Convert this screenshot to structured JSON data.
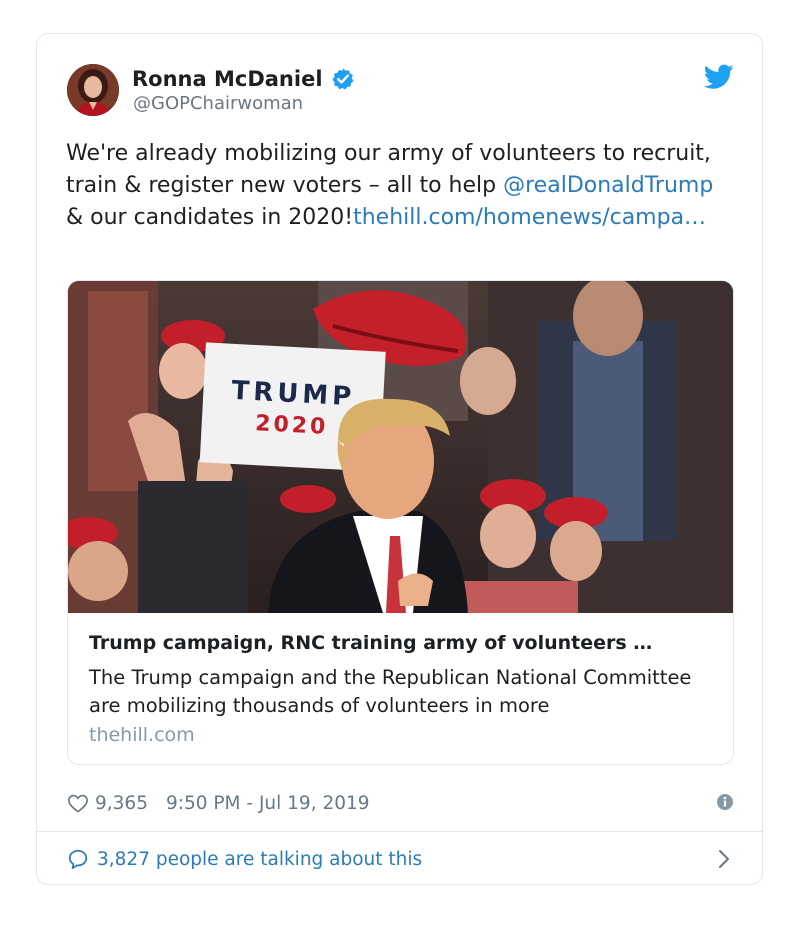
{
  "author": {
    "name": "Ronna McDaniel",
    "handle": "@GOPChairwoman",
    "verified": true
  },
  "tweet": {
    "text_1": "We're already mobilizing our army of volunteers to recruit, train & register new voters – all to help ",
    "mention": "@realDonaldTrump",
    "text_2": " & our candidates in 2020!",
    "url": "thehill.com/homenews/campa…"
  },
  "card": {
    "image_sign_line1": "TRUMP",
    "image_sign_line2": "2020",
    "title": "Trump campaign, RNC training army of volunteers …",
    "description": "The Trump campaign and the Republican National Committee are mobilizing thousands of volunteers in more",
    "domain": "thehill.com"
  },
  "meta": {
    "likes": "9,365",
    "timestamp": "9:50 PM - Jul 19, 2019"
  },
  "conversation": {
    "label": "3,827 people are talking about this"
  },
  "colors": {
    "link": "#2b7bb9",
    "secondary_text": "#697882",
    "twitter_blue": "#1da1f2",
    "border": "#e1e8ed"
  },
  "icons": [
    "verified-badge-icon",
    "twitter-bird-icon",
    "heart-icon",
    "info-icon",
    "comment-icon",
    "chevron-right-icon"
  ]
}
